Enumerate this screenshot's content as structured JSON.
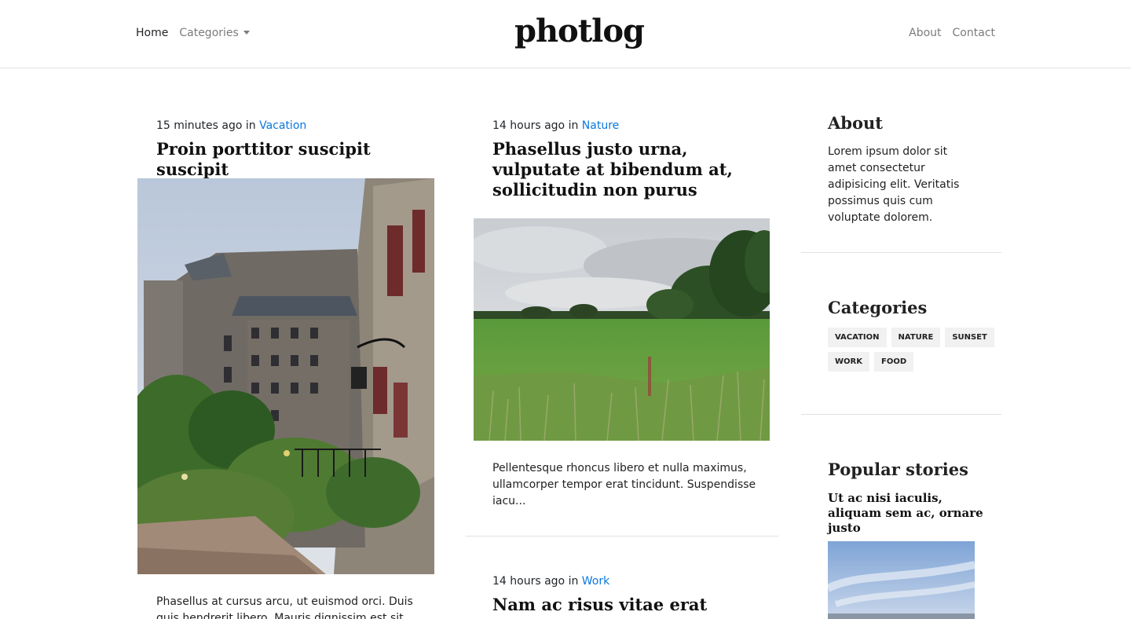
{
  "nav": {
    "home": "Home",
    "categories": "Categories",
    "brand": "photlog",
    "about": "About",
    "contact": "Contact"
  },
  "posts": [
    {
      "time": "15 minutes ago",
      "in": "in",
      "category": "Vacation",
      "title": "Proin porttitor suscipit suscipit",
      "excerpt": "Phasellus at cursus arcu, ut euismod orci. Duis quis hendrerit libero. Mauris dignissim est sit"
    },
    {
      "time": "14 hours ago",
      "in": "in",
      "category": "Nature",
      "title": "Phasellus justo urna, vulputate at bibendum at, sollicitudin non purus",
      "excerpt": "Pellentesque rhoncus libero et nulla maximus, ullamcorper tempor erat tincidunt. Suspendisse iacu..."
    },
    {
      "time": "14 hours ago",
      "in": "in",
      "category": "Work",
      "title": "Nam ac risus vitae erat"
    }
  ],
  "sidebar": {
    "about_heading": "About",
    "about_text": "Lorem ipsum dolor sit amet consectetur adipisicing elit. Veritatis possimus quis cum voluptate dolorem.",
    "categories_heading": "Categories",
    "tags": [
      "VACATION",
      "NATURE",
      "SUNSET",
      "WORK",
      "FOOD"
    ],
    "popular_heading": "Popular stories",
    "popular_title": "Ut ac nisi iaculis, aliquam sem ac, ornare justo"
  },
  "colors": {
    "link": "#0a78e0",
    "divider": "#dee2e6",
    "tag_bg": "#f1f1f1"
  }
}
